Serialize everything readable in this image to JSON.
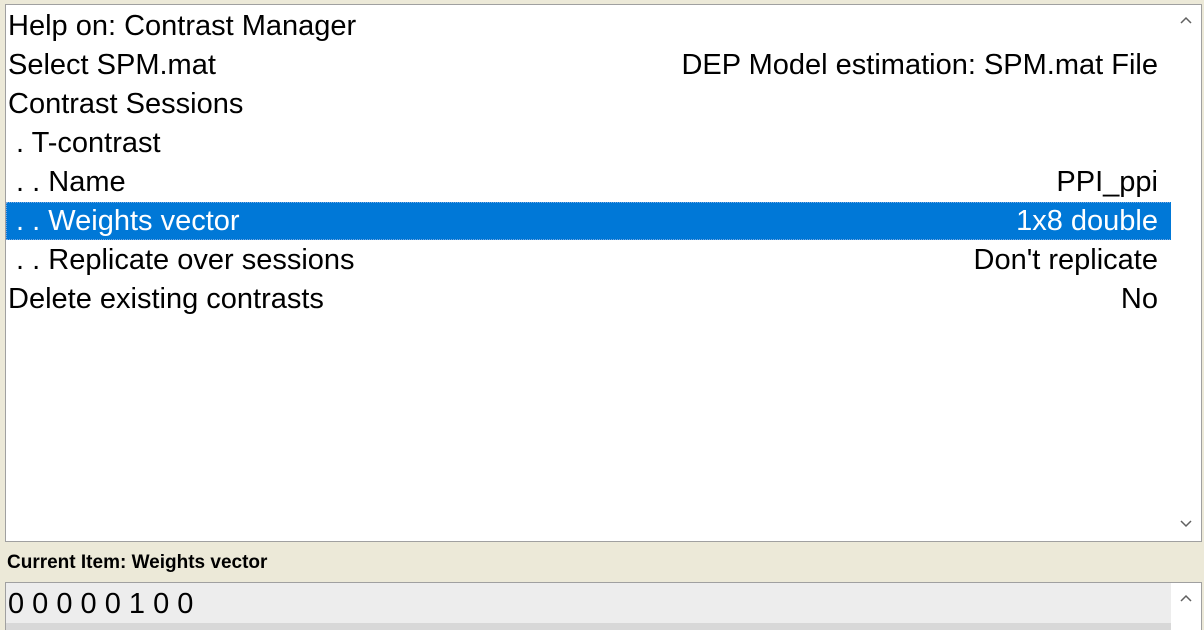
{
  "batch_tree": {
    "rows": [
      {
        "label": "Help on: Contrast Manager",
        "value": ""
      },
      {
        "label": "Select SPM.mat",
        "value": "DEP Model estimation: SPM.mat File"
      },
      {
        "label": "Contrast Sessions",
        "value": ""
      },
      {
        "label": " . T-contrast",
        "value": ""
      },
      {
        "label": " . . Name",
        "value": "PPI_ppi"
      },
      {
        "label": " . . Weights vector",
        "value": "1x8 double"
      },
      {
        "label": " . . Replicate over sessions",
        "value": "Don't replicate"
      },
      {
        "label": "Delete existing contrasts",
        "value": "No"
      }
    ],
    "selected_index": 5
  },
  "current_item": {
    "label": "Current Item: Weights vector",
    "value": "0 0 0 0 0 1 0 0"
  },
  "icons": {
    "scroll_up": "chevron-up-icon",
    "scroll_down": "chevron-down-icon"
  },
  "colors": {
    "selection": "#0078d7",
    "background": "#ece9d8"
  }
}
